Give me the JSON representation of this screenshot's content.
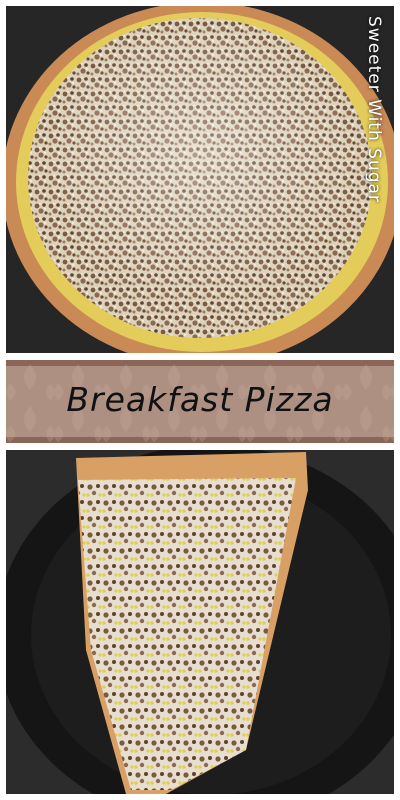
{
  "watermark": "Sweeter With Sugar",
  "title": "Breakfast Pizza",
  "colors": {
    "banner": "#8b6658",
    "crust": "#c98a56",
    "cheese": "#e8e0cc",
    "sausage": "#6b4a34",
    "egg": "#e3cc5a",
    "plate": "#1c1c1c"
  }
}
